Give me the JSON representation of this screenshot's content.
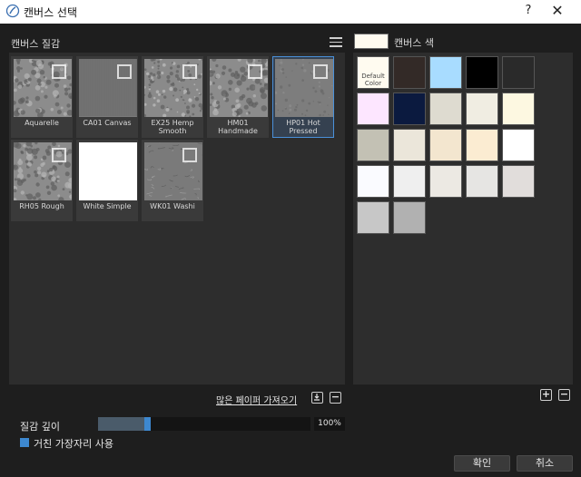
{
  "window": {
    "title": "캔버스 선택",
    "help_glyph": "?",
    "close_glyph": "✕"
  },
  "left": {
    "section_title": "캔버스 질감",
    "textures": [
      {
        "label": "Aquarelle",
        "style": "rough",
        "selected": false
      },
      {
        "label": "CA01 Canvas",
        "style": "canvas",
        "selected": false
      },
      {
        "label": "EX25 Hemp Smooth",
        "style": "hemp",
        "selected": false
      },
      {
        "label": "HM01 Handmade",
        "style": "rough",
        "selected": false
      },
      {
        "label": "HP01 Hot Pressed",
        "style": "fine",
        "selected": true
      },
      {
        "label": "RH05 Rough",
        "style": "rough",
        "selected": false
      },
      {
        "label": "White Simple",
        "style": "white",
        "selected": false
      },
      {
        "label": "WK01 Washi",
        "style": "washi",
        "selected": false
      }
    ],
    "import_link": "많은 페이퍼 가져오기"
  },
  "right": {
    "section_title": "캔버스 색",
    "selected_color": "#fffbf0",
    "swatches": [
      {
        "color": "#fffbf0",
        "label": "Default Color"
      },
      {
        "color": "#332a27",
        "label": ""
      },
      {
        "color": "#a8dcff",
        "label": ""
      },
      {
        "color": "#000000",
        "label": ""
      },
      {
        "color": "#2a2a2a",
        "label": ""
      },
      {
        "color": "#fde6ff",
        "label": ""
      },
      {
        "color": "#0b1a3f",
        "label": ""
      },
      {
        "color": "#dedbd0",
        "label": ""
      },
      {
        "color": "#f0ede2",
        "label": ""
      },
      {
        "color": "#fdf8e1",
        "label": ""
      },
      {
        "color": "#c3c1b4",
        "label": ""
      },
      {
        "color": "#ebe6da",
        "label": ""
      },
      {
        "color": "#f3e6cf",
        "label": ""
      },
      {
        "color": "#fbecd2",
        "label": ""
      },
      {
        "color": "#ffffff",
        "label": ""
      },
      {
        "color": "#fafbff",
        "label": ""
      },
      {
        "color": "#efefef",
        "label": ""
      },
      {
        "color": "#ece9e3",
        "label": ""
      },
      {
        "color": "#e6e5e3",
        "label": ""
      },
      {
        "color": "#e1dddb",
        "label": ""
      },
      {
        "color": "#c7c7c7",
        "label": ""
      },
      {
        "color": "#b1b1b1",
        "label": ""
      }
    ]
  },
  "controls": {
    "depth_label": "질감 깊이",
    "depth_percent": "100%",
    "depth_fraction": 0.22,
    "rough_edge_label": "거친 가장자리 사용",
    "rough_edge_checked": true,
    "add_glyph": "+",
    "remove_glyph": "−"
  },
  "buttons": {
    "ok": "확인",
    "cancel": "취소"
  },
  "icons": {
    "app": "brush-stroke-icon",
    "menu": "hamburger-menu-icon",
    "import": "import-icon",
    "remove": "minus-icon",
    "add": "plus-icon"
  },
  "colors": {
    "accent": "#3d88d0",
    "panel": "#2d2d2d",
    "background": "#1e1e1e"
  }
}
